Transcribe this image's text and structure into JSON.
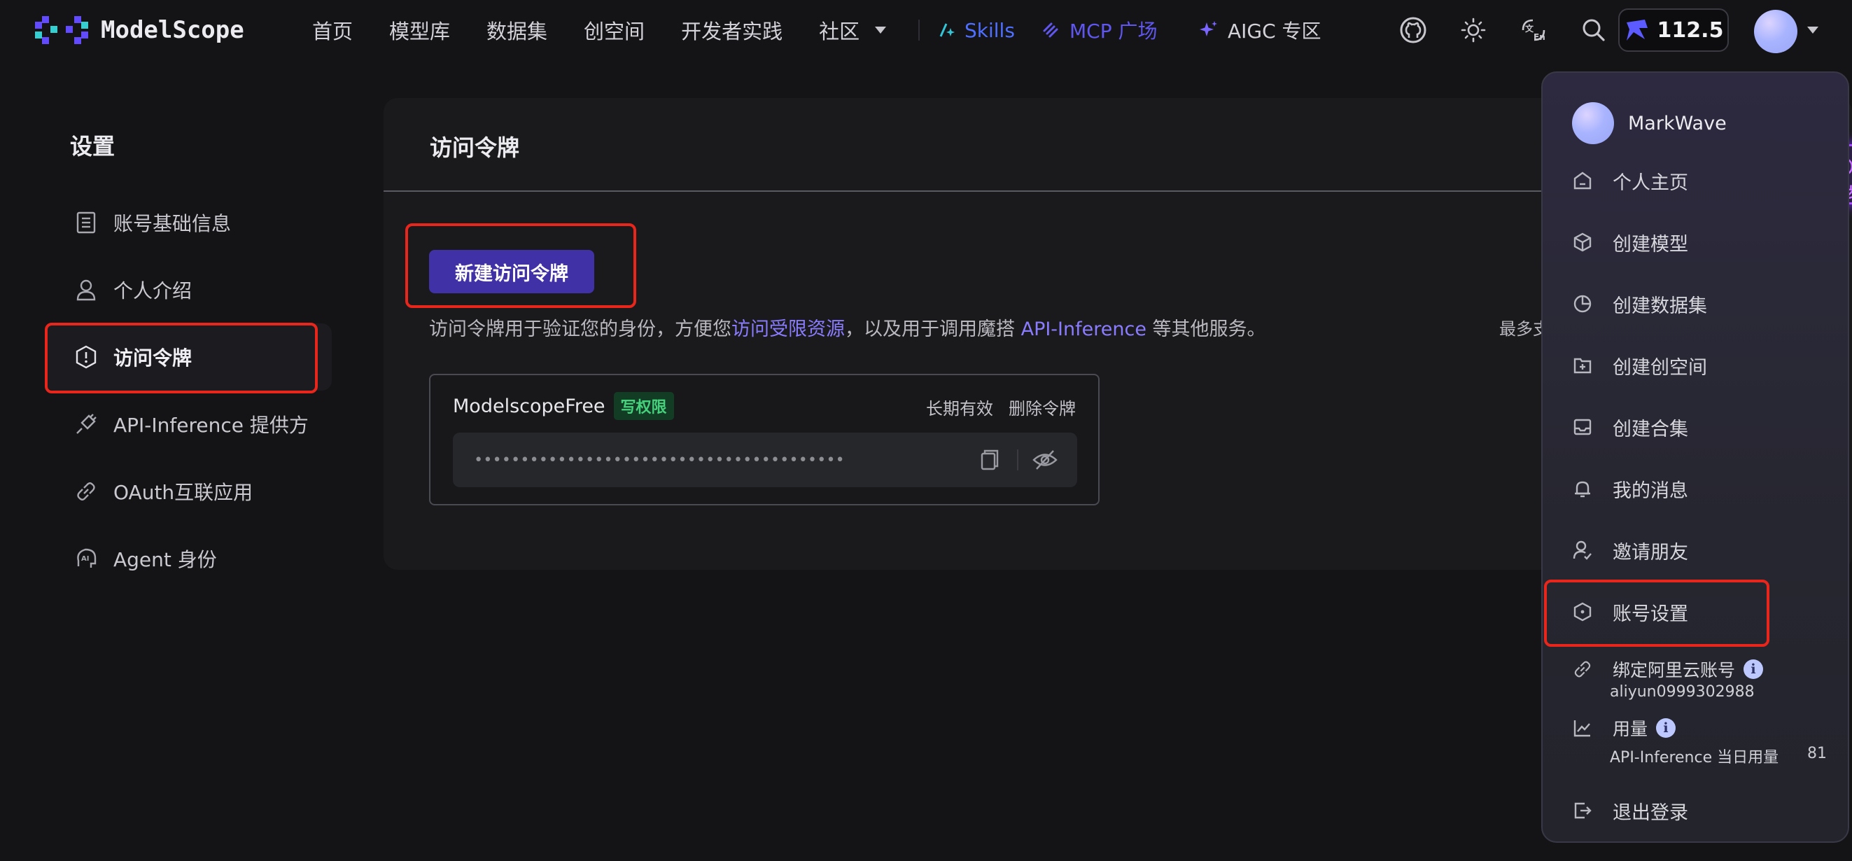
{
  "nav": {
    "logo_text": "ModelScope",
    "items": [
      "首页",
      "模型库",
      "数据集",
      "创空间",
      "开发者实践",
      "社区"
    ],
    "skills": "Skills",
    "mcp": "MCP 广场",
    "aigc": "AIGC 专区",
    "credits": "112.5"
  },
  "sidebar": {
    "title": "设置",
    "items": [
      {
        "label": "账号基础信息",
        "icon": "document-icon"
      },
      {
        "label": "个人介绍",
        "icon": "user-icon"
      },
      {
        "label": "访问令牌",
        "icon": "token-shield-icon"
      },
      {
        "label": "API-Inference 提供方",
        "icon": "plug-icon"
      },
      {
        "label": "OAuth互联应用",
        "icon": "link-icon"
      },
      {
        "label": "Agent 身份",
        "icon": "ai-agent-icon"
      }
    ]
  },
  "main": {
    "title": "访问令牌",
    "new_token_button": "新建访问令牌",
    "desc_prefix": "访问令牌用于验证您的身份，方便您",
    "desc_link1": "访问受限资源",
    "desc_middle": "，以及用于调用魔搭 ",
    "desc_link2": "API-Inference",
    "desc_suffix": " 等其他服务。",
    "desc_right": "最多支",
    "token": {
      "name": "ModelscopeFree",
      "tag": "写权限",
      "validity": "长期有效",
      "delete": "删除令牌",
      "masked_value": "••••••••••••••••••••••••••••••••••••••••"
    }
  },
  "dropdown": {
    "username": "MarkWave",
    "items": [
      "个人主页",
      "创建模型",
      "创建数据集",
      "创建创空间",
      "创建合集",
      "我的消息",
      "邀请朋友",
      "账号设置"
    ],
    "bind_aliyun": "绑定阿里云账号",
    "aliyun_id": "aliyun0999302988",
    "usage": "用量",
    "usage_sub": "API-Inference 当日用量",
    "usage_value": "81",
    "logout": "退出登录"
  },
  "side_tab": "同步",
  "colors": {
    "primary_button": "#4131a7",
    "link": "#8a7cff",
    "highlight": "#e8261c",
    "skills": "#4e6fff",
    "mcp": "#5f57f0"
  }
}
